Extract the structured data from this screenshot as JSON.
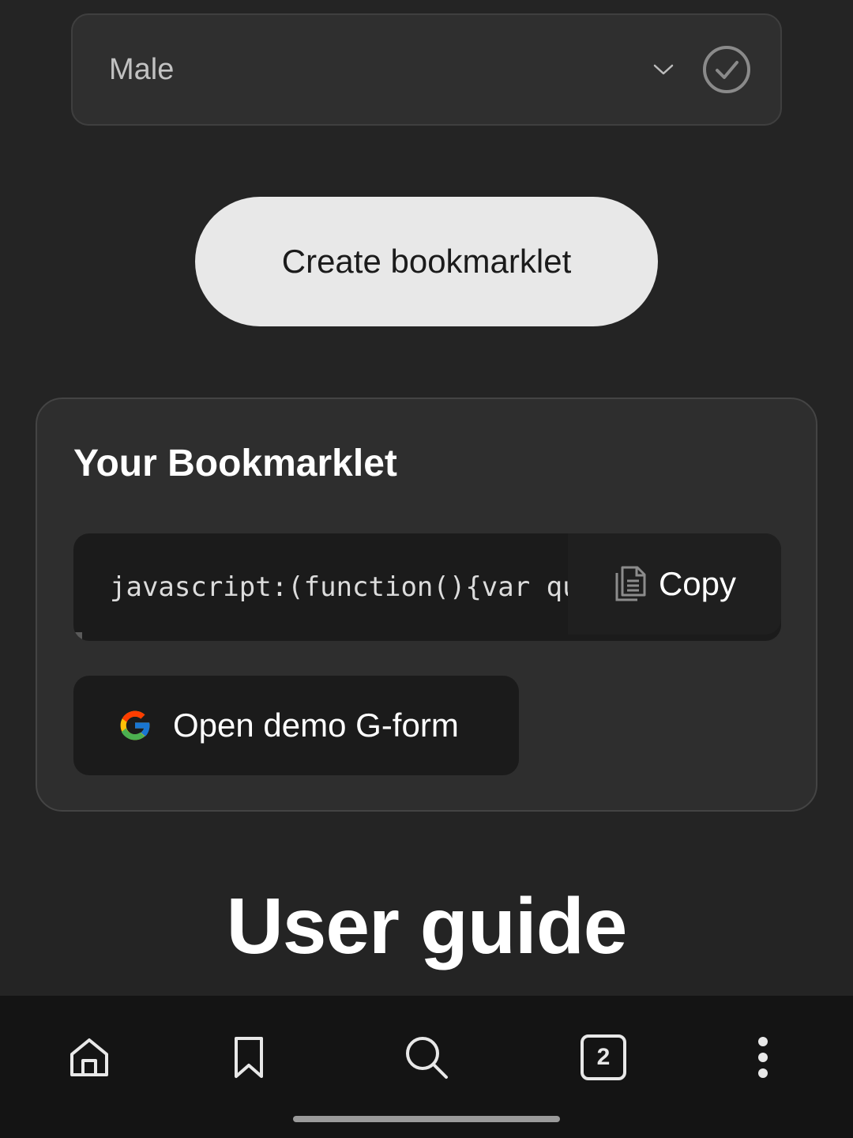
{
  "gender_select": {
    "value": "Male"
  },
  "create_button": {
    "label": "Create bookmarklet"
  },
  "bookmarklet_card": {
    "title": "Your Bookmarklet",
    "code": "javascript:(function(){var qu",
    "copy_label": "Copy",
    "gform_label": "Open demo G-form"
  },
  "section": {
    "title": "User guide"
  },
  "bottom_nav": {
    "tab_count": "2",
    "items": [
      "home-icon",
      "bookmark-icon",
      "search-icon",
      "tabs-icon",
      "more-icon"
    ]
  },
  "colors": {
    "background": "#242424",
    "card": "#2e2e2e",
    "button_light": "#e8e8e8",
    "nav_bar": "#141414"
  }
}
